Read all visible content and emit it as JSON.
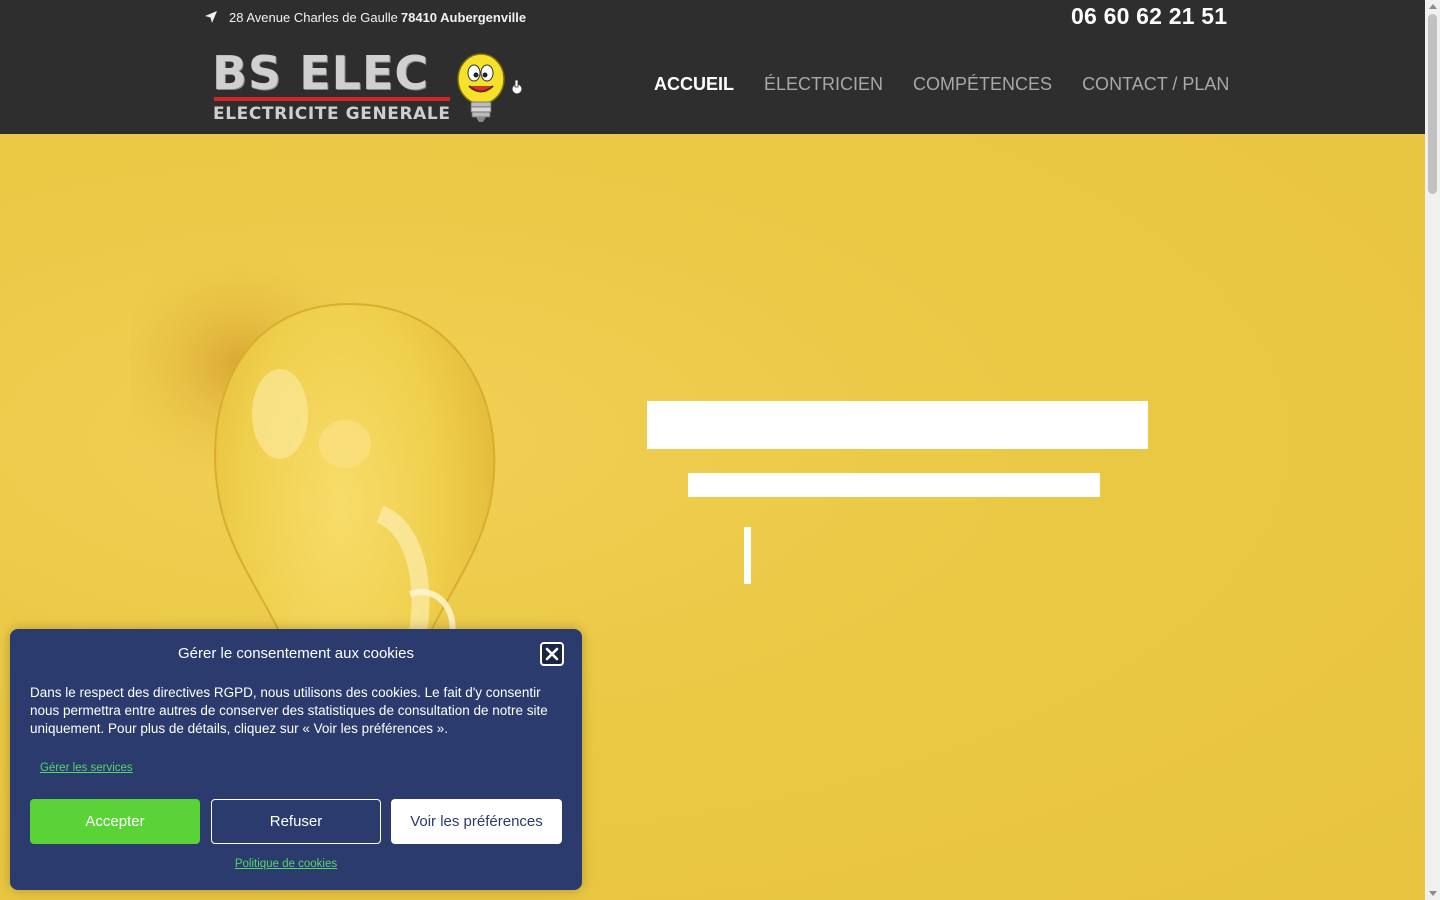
{
  "header": {
    "address_street": "28 Avenue Charles de Gaulle",
    "address_city": "78410 Aubergenville",
    "phone": "06 60 62 21 51",
    "logo_main": "BS ELEC",
    "logo_sub": "ELECTRICITE GENERALE",
    "nav": [
      {
        "label": "ACCUEIL",
        "active": true
      },
      {
        "label": "ÉLECTRICIEN",
        "active": false
      },
      {
        "label": "COMPÉTENCES",
        "active": false
      },
      {
        "label": "CONTACT / PLAN",
        "active": false
      }
    ]
  },
  "cookie": {
    "title": "Gérer le consentement aux cookies",
    "text": "Dans le respect des directives RGPD, nous utilisons des cookies. Le fait d'y consentir nous permettra entre autres de conserver des statistiques de consultation de notre site uniquement. Pour plus de détails, cliquez sur « Voir les préférences ».",
    "manage_services": "Gérer les services",
    "accept": "Accepter",
    "refuse": "Refuser",
    "preferences": "Voir les préférences",
    "policy": "Politique de cookies"
  },
  "colors": {
    "header_bg": "#2e2e2e",
    "hero_bg": "#e8c440",
    "cookie_bg": "#2b3b6e",
    "accept_green": "#5ad336",
    "link_green": "#55d66a",
    "logo_red": "#d32424"
  },
  "icons": {
    "address": "location-arrow-icon",
    "close": "close-icon"
  }
}
